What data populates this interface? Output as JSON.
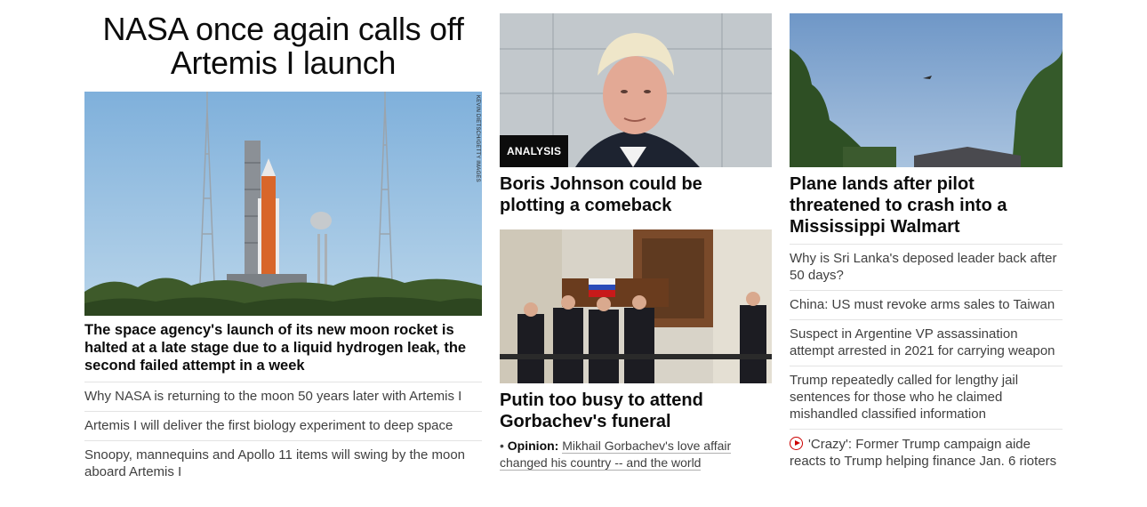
{
  "lead": {
    "title": "NASA once again calls off Artemis I launch",
    "image_credit": "KEVIN DIETSCH/GETTY IMAGES",
    "summary": "The space agency's launch of its new moon rocket is halted at a late stage due to a liquid hydrogen leak, the second failed attempt in a week",
    "related": [
      "Why NASA is returning to the moon 50 years later with Artemis I",
      "Artemis I will deliver the first biology experiment to deep space",
      "Snoopy, mannequins and Apollo 11 items will swing by the moon aboard Artemis I"
    ]
  },
  "johnson": {
    "badge": "ANALYSIS",
    "title": "Boris Johnson could be plotting a comeback"
  },
  "putin": {
    "title": "Putin too busy to attend Gorbachev's funeral",
    "opinion_label": "Opinion:",
    "opinion_bullet": "•",
    "opinion_link": "Mikhail Gorbachev's love affair changed his country -- and the world"
  },
  "plane": {
    "title": "Plane lands after pilot threatened to crash into a Mississippi Walmart",
    "related": [
      "Why is Sri Lanka's deposed leader back after 50 days?",
      "China: US must revoke arms sales to Taiwan",
      "Suspect in Argentine VP assassination attempt arrested in 2021 for carrying weapon",
      "Trump repeatedly called for lengthy jail sentences for those who he claimed mishandled classified information"
    ],
    "video_item": "'Crazy': Former Trump campaign aide reacts to Trump helping finance Jan. 6 rioters",
    "video_icon": "play-circle-icon"
  },
  "colors": {
    "text": "#0c0c0c",
    "secondary_text": "#404040",
    "divider": "#e3e3e3",
    "badge_bg": "#0c0c0c",
    "video_accent": "#cc0000"
  }
}
